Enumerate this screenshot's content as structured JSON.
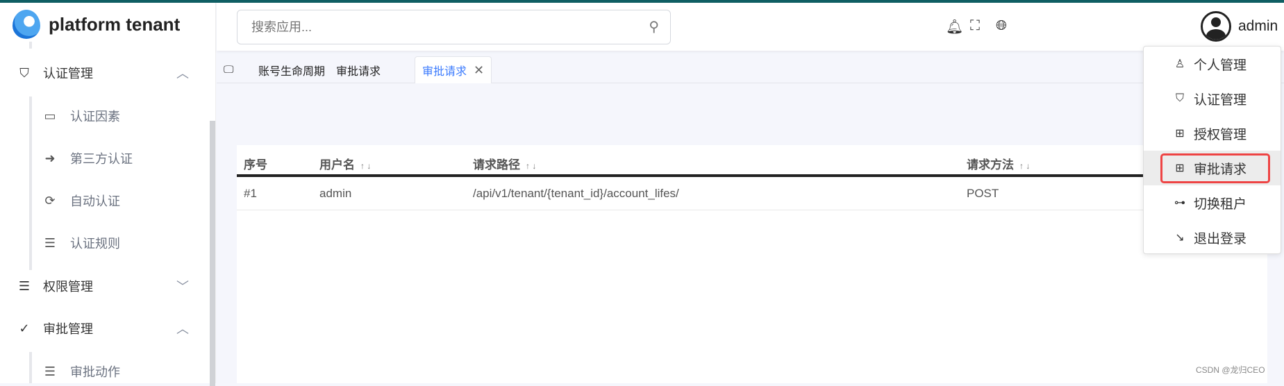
{
  "app": {
    "title": "platform tenant",
    "accent": "#3a7afe",
    "top_line_color": "#0f5e63"
  },
  "search": {
    "placeholder": "搜索应用..."
  },
  "header": {
    "username": "admin"
  },
  "sidebar": {
    "groups": [
      {
        "label": "认证管理",
        "icon": "shield-check-icon",
        "expanded": true,
        "items": [
          {
            "label": "认证因素",
            "icon": "calendar-icon"
          },
          {
            "label": "第三方认证",
            "icon": "arrow-circle-right-icon"
          },
          {
            "label": "自动认证",
            "icon": "refresh-icon"
          },
          {
            "label": "认证规则",
            "icon": "list-icon"
          }
        ]
      },
      {
        "label": "权限管理",
        "icon": "list-icon",
        "expanded": false,
        "items": []
      },
      {
        "label": "审批管理",
        "icon": "check-circle-icon",
        "expanded": true,
        "items": [
          {
            "label": "审批动作",
            "icon": "list-icon"
          }
        ]
      }
    ]
  },
  "tabs": [
    {
      "label": "账号生命周期"
    },
    {
      "label": "审批请求"
    },
    {
      "label": "审批请求",
      "active": true
    }
  ],
  "table": {
    "columns": [
      "序号",
      "用户名",
      "请求路径",
      "请求方法"
    ],
    "sort_label": "↑ ↓",
    "rows": [
      [
        "#1",
        "admin",
        "/api/v1/tenant/{tenant_id}/account_lifes/",
        "POST"
      ]
    ]
  },
  "user_menu": [
    {
      "label": "个人管理",
      "icon": "user-icon"
    },
    {
      "label": "认证管理",
      "icon": "shield-check-icon"
    },
    {
      "label": "授权管理",
      "icon": "grid-icon"
    },
    {
      "label": "审批请求",
      "icon": "grid-icon",
      "highlighted": true
    },
    {
      "label": "切换租户",
      "icon": "toggle-icon"
    },
    {
      "label": "退出登录",
      "icon": "logout-icon"
    }
  ],
  "watermark": "CSDN @龙归CEO"
}
